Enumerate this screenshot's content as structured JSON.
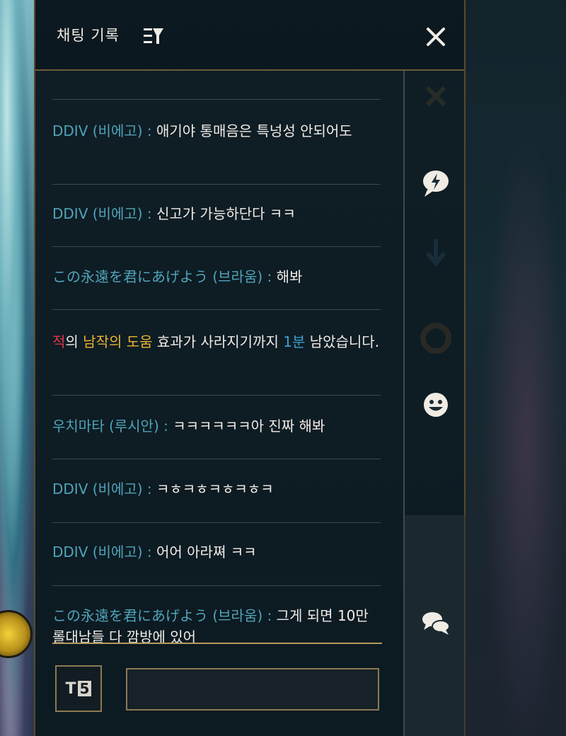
{
  "header": {
    "title": "채팅 기록"
  },
  "messages": [
    {
      "sender": "DDIV (비에고)",
      "sep": " : ",
      "text": "애기야 통매음은 특넝성 안되어도"
    },
    {
      "sender": "DDIV (비에고)",
      "sep": " : ",
      "text": "신고가 가능하단다 ㅋㅋ"
    },
    {
      "sender": "この永遠を君にあげよう (브라움)",
      "sep": " : ",
      "text": "해봐"
    },
    {
      "system": {
        "part1": "적",
        "part2": "의 ",
        "part3": "남작의 도움",
        "part4": " 효과가 사라지기까지 ",
        "part5": "1분",
        "part6": " 남았습니다."
      }
    },
    {
      "sender": "우치마타 (루시안)",
      "sep": " : ",
      "text": "ㅋㅋㅋㅋㅋㅋ아 진짜 해봐"
    },
    {
      "sender": "DDIV (비에고)",
      "sep": " : ",
      "text": "ㅋㅎㅋㅎㅋㅎㅋㅎㅋ"
    },
    {
      "sender": "DDIV (비에고)",
      "sep": " : ",
      "text": "어어 아라쪄 ㅋㅋ"
    },
    {
      "sender": "この永遠を君にあげよう (브라움)",
      "sep": " : ",
      "text": "그게 되면 10만 롤대남들 다 깜방에 있어"
    }
  ],
  "input": {
    "mode_label": "T",
    "mode_badge": "5",
    "value": ""
  },
  "sidebar_icons": [
    "close-x-icon",
    "ping-icon",
    "arrow-down-icon",
    "lifebuoy-icon",
    "emote-icon",
    "chat-bubbles-icon"
  ],
  "colors": {
    "name": "#4fa4b8",
    "enemy": "#e0384a",
    "buff": "#e8b432",
    "time": "#3d9fd0",
    "border_gold": "#b59a5a"
  }
}
